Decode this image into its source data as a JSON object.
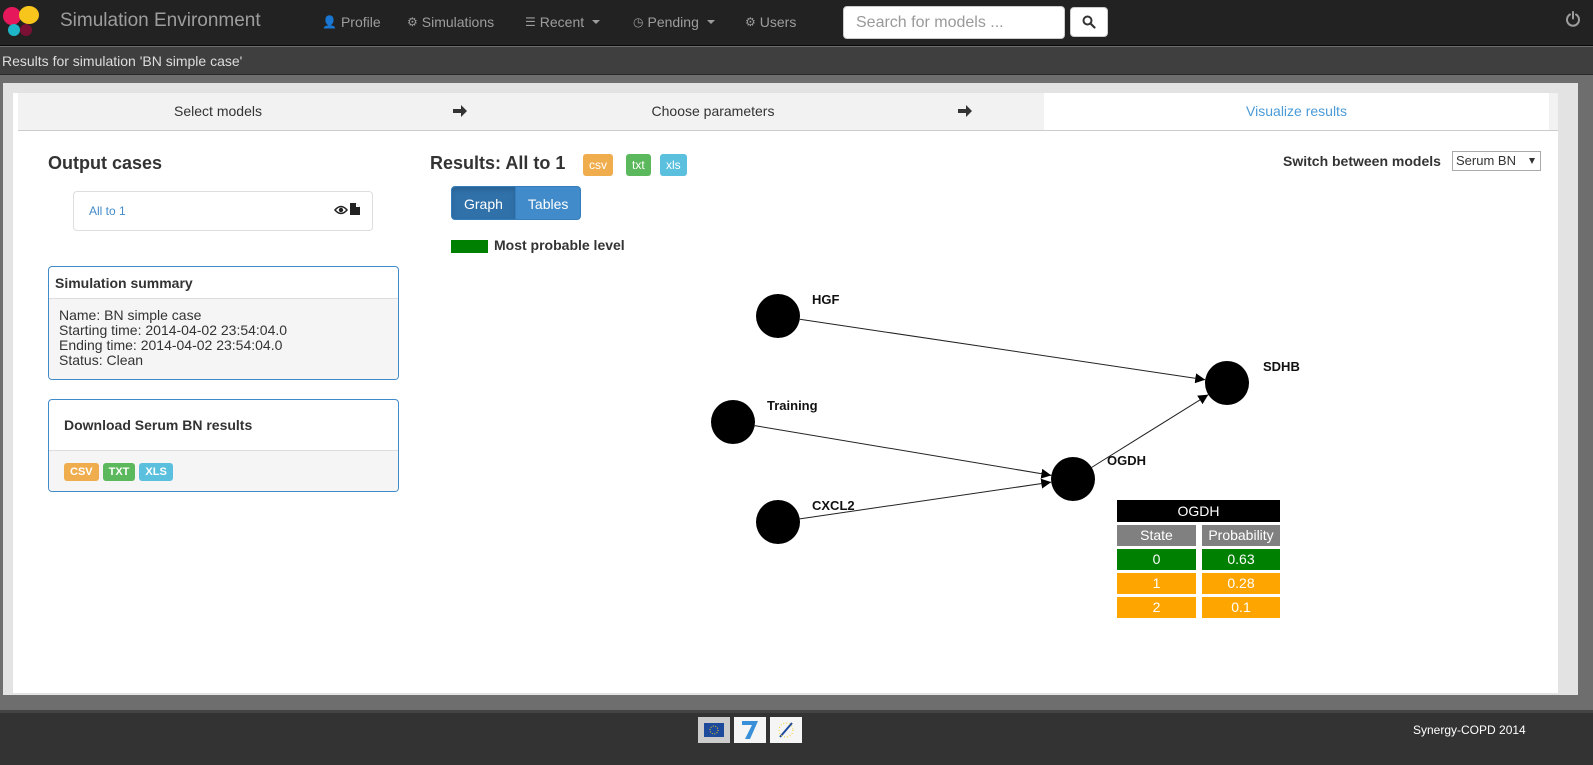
{
  "navbar": {
    "brand": "Simulation Environment",
    "items": [
      {
        "label": "Profile",
        "icon": "user-icon"
      },
      {
        "label": "Simulations",
        "icon": "gear-icon"
      },
      {
        "label": "Recent",
        "icon": "list-icon",
        "dropdown": true
      },
      {
        "label": "Pending",
        "icon": "clock-icon",
        "dropdown": true
      },
      {
        "label": "Users",
        "icon": "gear-icon"
      }
    ],
    "search": {
      "placeholder": "Search for models ...",
      "value": ""
    }
  },
  "subheader": {
    "text": "Results for simulation 'BN simple case'"
  },
  "wizard": {
    "steps": [
      {
        "label": "Select models",
        "active": false
      },
      {
        "label": "Choose parameters",
        "active": false
      },
      {
        "label": "Visualize results",
        "active": true
      }
    ]
  },
  "output_cases": {
    "title": "Output cases",
    "items": [
      {
        "label": "All to 1"
      }
    ]
  },
  "summary": {
    "title": "Simulation summary",
    "name": "Name: BN simple case",
    "start": "Starting time: 2014-04-02 23:54:04.0",
    "end": "Ending time: 2014-04-02 23:54:04.0",
    "status": "Status: Clean"
  },
  "download": {
    "title": "Download Serum BN results",
    "formats": [
      "CSV",
      "TXT",
      "XLS"
    ]
  },
  "results": {
    "title": "Results: All to 1",
    "formats": [
      "csv",
      "txt",
      "xls"
    ],
    "view_tabs": [
      "Graph",
      "Tables"
    ],
    "active_tab": "Graph",
    "legend": "Most probable level",
    "switch_label": "Switch between models",
    "selected_model": "Serum BN"
  },
  "graph": {
    "nodes": [
      "HGF",
      "Training",
      "CXCL2",
      "OGDH",
      "SDHB"
    ],
    "edges": [
      {
        "from": "HGF",
        "to": "SDHB"
      },
      {
        "from": "Training",
        "to": "OGDH"
      },
      {
        "from": "CXCL2",
        "to": "OGDH"
      },
      {
        "from": "OGDH",
        "to": "SDHB"
      }
    ]
  },
  "cpt": {
    "node": "OGDH",
    "headers": [
      "State",
      "Probability"
    ],
    "rows": [
      {
        "state": "0",
        "prob": "0.63",
        "most_probable": true
      },
      {
        "state": "1",
        "prob": "0.28",
        "most_probable": false
      },
      {
        "state": "2",
        "prob": "0.1",
        "most_probable": false
      }
    ]
  },
  "colors": {
    "most_probable": "#008000",
    "other": "#FFA500"
  },
  "footer": {
    "text": "Synergy-COPD 2014"
  }
}
